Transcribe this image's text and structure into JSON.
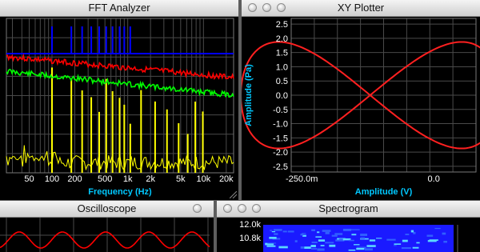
{
  "windows": {
    "fft": {
      "title": "FFT Analyzer"
    },
    "xy": {
      "title": "XY Plotter"
    },
    "osc": {
      "title": "Oscilloscope"
    },
    "spec": {
      "title": "Spectrogram"
    }
  },
  "colors": {
    "axis_label": "#00c8ff",
    "tick_label": "#ffffff",
    "grid": "#4a4a4a"
  },
  "chart_data": [
    {
      "type": "line",
      "xlabel": "Frequency (Hz)",
      "ylabel": "",
      "x_scale": "log",
      "x_ticks": [
        "50",
        "100",
        "200",
        "500",
        "1k",
        "2k",
        "5k",
        "10k",
        "20k"
      ],
      "x_tick_values": [
        50,
        100,
        200,
        500,
        1000,
        2000,
        5000,
        10000,
        20000
      ],
      "xlim": [
        25,
        25000
      ],
      "grid": true,
      "series": [
        {
          "color": "#0000ff",
          "style": "flat line with tall peaks at harmonics"
        },
        {
          "color": "#ff0000",
          "style": "noisy line slowly decreasing"
        },
        {
          "color": "#00ff00",
          "style": "noisy line slowly decreasing"
        },
        {
          "color": "#ffff00",
          "style": "spectrum spikes at harmonics"
        }
      ],
      "harmonics_hz": [
        100,
        180,
        250,
        330,
        420,
        520,
        630,
        780,
        900,
        1080,
        1500,
        2300,
        3300,
        4700,
        6200,
        7800,
        9800
      ]
    },
    {
      "type": "line",
      "xlabel": "Amplitude (V)",
      "ylabel": "Amplitude (Pa)",
      "x_ticks": [
        "-250.0m",
        "0.0"
      ],
      "x_tick_values": [
        -0.25,
        0.0
      ],
      "xlim": [
        -0.27,
        0.08
      ],
      "y_ticks": [
        "2.5",
        "2.0",
        "1.5",
        "1.0",
        "0.5",
        "0.0",
        "-0.5",
        "-1.0",
        "-1.5",
        "-2.0",
        "-2.5"
      ],
      "y_tick_values": [
        2.5,
        2.0,
        1.5,
        1.0,
        0.5,
        0.0,
        -0.5,
        -1.0,
        -1.5,
        -2.0,
        -2.5
      ],
      "ylim": [
        -2.7,
        2.7
      ],
      "grid": true,
      "series": [
        {
          "color": "#ff2020",
          "shape": "figure-eight (Lissajous)",
          "x_amplitude": 0.25,
          "y_amplitude": 1.9
        }
      ]
    },
    {
      "type": "line",
      "grid": true,
      "series": [
        {
          "color": "#ff0000",
          "shape": "sine wave"
        }
      ]
    },
    {
      "type": "heatmap",
      "y_ticks": [
        "12.0k",
        "10.8k"
      ],
      "y_tick_values": [
        12000,
        10800
      ],
      "colormap": "blue"
    }
  ]
}
